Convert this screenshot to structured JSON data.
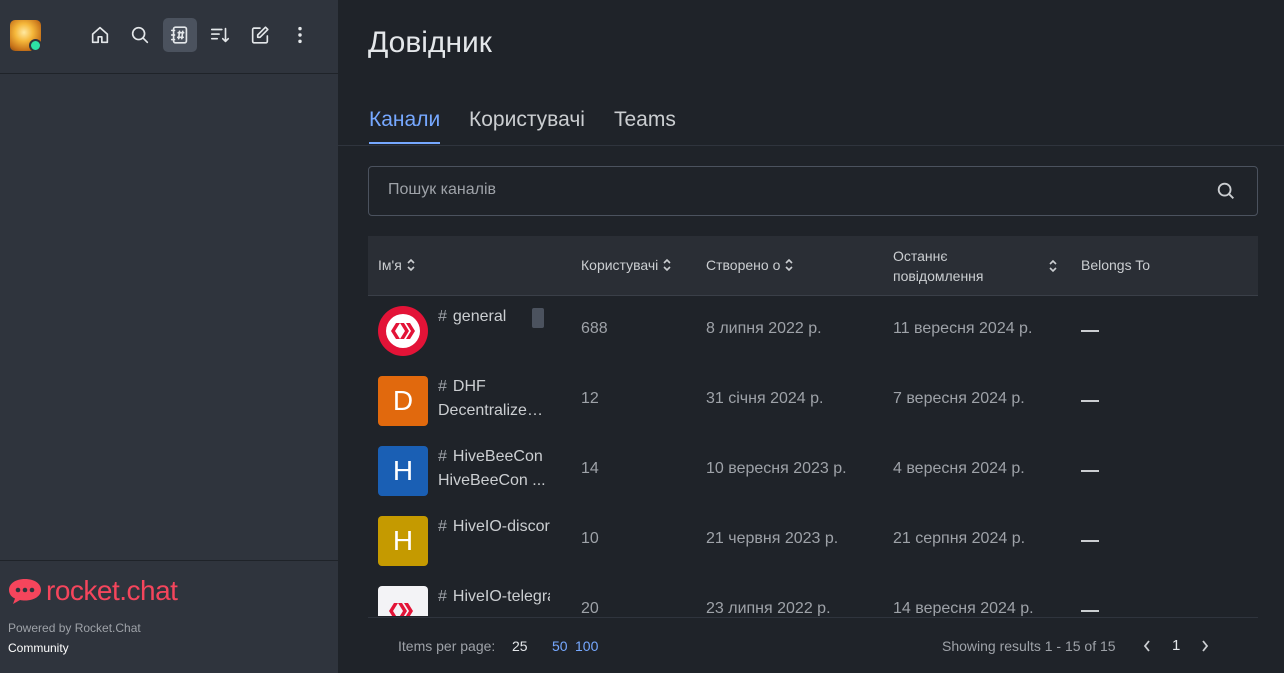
{
  "sidebar": {
    "icons": [
      "home-icon",
      "search-icon",
      "directory-icon",
      "sort-icon",
      "edit-icon",
      "kebab-menu-icon"
    ],
    "logo_text": "rocket.chat",
    "powered_by": "Powered by Rocket.Chat",
    "edition": "Community",
    "brand_color": "#f5455c",
    "status_color": "#2de0a5"
  },
  "main": {
    "title": "Довідник",
    "tabs": [
      {
        "label": "Канали",
        "active": true
      },
      {
        "label": "Користувачі",
        "active": false
      },
      {
        "label": "Teams",
        "active": false
      }
    ],
    "search": {
      "placeholder": "Пошук каналів"
    },
    "table": {
      "headers": {
        "name": "Ім'я",
        "users": "Користувачі",
        "created": "Створено о",
        "last_message": "Останнє повідомлення",
        "belongs_to": "Belongs To"
      },
      "rows": [
        {
          "avatar": "hive-logo",
          "avatar_letter": "",
          "avatar_color": "#e31337",
          "name": "general",
          "topic": "",
          "users": "688",
          "created": "8 липня 2022 р.",
          "last_message": "11 вересня 2024 р.",
          "belongs_to": "—"
        },
        {
          "avatar": "letter",
          "avatar_letter": "D",
          "avatar_color": "#e1690d",
          "name": "DHF",
          "topic": "Decentralized Hive Fund",
          "users": "12",
          "created": "31 січня 2024 р.",
          "last_message": "7 вересня 2024 р.",
          "belongs_to": "—"
        },
        {
          "avatar": "letter",
          "avatar_letter": "H",
          "avatar_color": "#1a5fb4",
          "name": "HiveBeeCon",
          "topic": "HiveBeeCon ...",
          "users": "14",
          "created": "10 вересня 2023 р.",
          "last_message": "4 вересня 2024 р.",
          "belongs_to": "—"
        },
        {
          "avatar": "letter",
          "avatar_letter": "H",
          "avatar_color": "#c59a00",
          "name": "HiveIO-discord",
          "topic": "",
          "users": "10",
          "created": "21 червня 2023 р.",
          "last_message": "21 серпня 2024 р.",
          "belongs_to": "—"
        },
        {
          "avatar": "hive-logo-light",
          "avatar_letter": "",
          "avatar_color": "#f3f3f6",
          "name": "HiveIO-telegram",
          "topic": "",
          "users": "20",
          "created": "23 липня 2022 р.",
          "last_message": "14 вересня 2024 р.",
          "belongs_to": "—"
        }
      ]
    },
    "pagination": {
      "items_per_page_label": "Items per page:",
      "options": [
        "25",
        "50",
        "100"
      ],
      "selected": "25",
      "results_text": "Showing results 1 - 15 of 15",
      "current_page": "1"
    },
    "accent_color": "#76a8ff"
  }
}
